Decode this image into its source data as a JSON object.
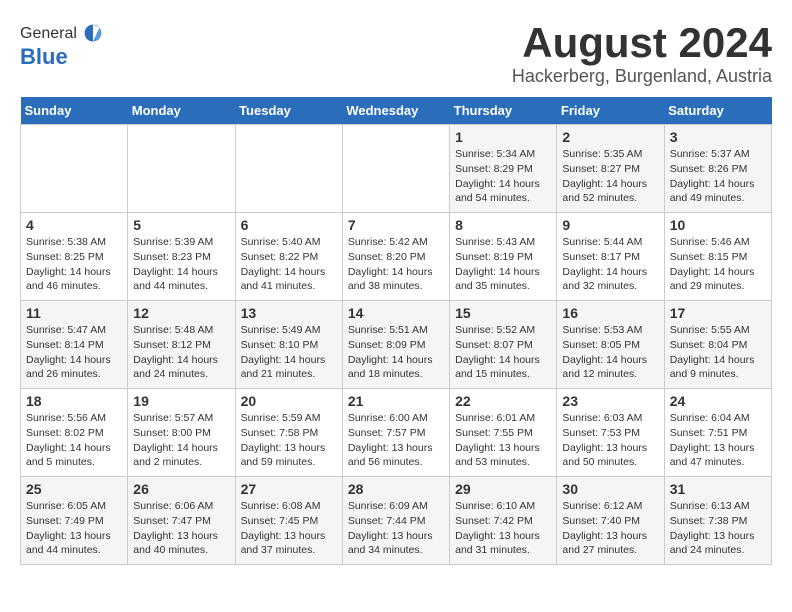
{
  "logo": {
    "general": "General",
    "blue": "Blue"
  },
  "header": {
    "month_year": "August 2024",
    "location": "Hackerberg, Burgenland, Austria"
  },
  "days_of_week": [
    "Sunday",
    "Monday",
    "Tuesday",
    "Wednesday",
    "Thursday",
    "Friday",
    "Saturday"
  ],
  "weeks": [
    [
      {
        "day": "",
        "info": ""
      },
      {
        "day": "",
        "info": ""
      },
      {
        "day": "",
        "info": ""
      },
      {
        "day": "",
        "info": ""
      },
      {
        "day": "1",
        "info": "Sunrise: 5:34 AM\nSunset: 8:29 PM\nDaylight: 14 hours\nand 54 minutes."
      },
      {
        "day": "2",
        "info": "Sunrise: 5:35 AM\nSunset: 8:27 PM\nDaylight: 14 hours\nand 52 minutes."
      },
      {
        "day": "3",
        "info": "Sunrise: 5:37 AM\nSunset: 8:26 PM\nDaylight: 14 hours\nand 49 minutes."
      }
    ],
    [
      {
        "day": "4",
        "info": "Sunrise: 5:38 AM\nSunset: 8:25 PM\nDaylight: 14 hours\nand 46 minutes."
      },
      {
        "day": "5",
        "info": "Sunrise: 5:39 AM\nSunset: 8:23 PM\nDaylight: 14 hours\nand 44 minutes."
      },
      {
        "day": "6",
        "info": "Sunrise: 5:40 AM\nSunset: 8:22 PM\nDaylight: 14 hours\nand 41 minutes."
      },
      {
        "day": "7",
        "info": "Sunrise: 5:42 AM\nSunset: 8:20 PM\nDaylight: 14 hours\nand 38 minutes."
      },
      {
        "day": "8",
        "info": "Sunrise: 5:43 AM\nSunset: 8:19 PM\nDaylight: 14 hours\nand 35 minutes."
      },
      {
        "day": "9",
        "info": "Sunrise: 5:44 AM\nSunset: 8:17 PM\nDaylight: 14 hours\nand 32 minutes."
      },
      {
        "day": "10",
        "info": "Sunrise: 5:46 AM\nSunset: 8:15 PM\nDaylight: 14 hours\nand 29 minutes."
      }
    ],
    [
      {
        "day": "11",
        "info": "Sunrise: 5:47 AM\nSunset: 8:14 PM\nDaylight: 14 hours\nand 26 minutes."
      },
      {
        "day": "12",
        "info": "Sunrise: 5:48 AM\nSunset: 8:12 PM\nDaylight: 14 hours\nand 24 minutes."
      },
      {
        "day": "13",
        "info": "Sunrise: 5:49 AM\nSunset: 8:10 PM\nDaylight: 14 hours\nand 21 minutes."
      },
      {
        "day": "14",
        "info": "Sunrise: 5:51 AM\nSunset: 8:09 PM\nDaylight: 14 hours\nand 18 minutes."
      },
      {
        "day": "15",
        "info": "Sunrise: 5:52 AM\nSunset: 8:07 PM\nDaylight: 14 hours\nand 15 minutes."
      },
      {
        "day": "16",
        "info": "Sunrise: 5:53 AM\nSunset: 8:05 PM\nDaylight: 14 hours\nand 12 minutes."
      },
      {
        "day": "17",
        "info": "Sunrise: 5:55 AM\nSunset: 8:04 PM\nDaylight: 14 hours\nand 9 minutes."
      }
    ],
    [
      {
        "day": "18",
        "info": "Sunrise: 5:56 AM\nSunset: 8:02 PM\nDaylight: 14 hours\nand 5 minutes."
      },
      {
        "day": "19",
        "info": "Sunrise: 5:57 AM\nSunset: 8:00 PM\nDaylight: 14 hours\nand 2 minutes."
      },
      {
        "day": "20",
        "info": "Sunrise: 5:59 AM\nSunset: 7:58 PM\nDaylight: 13 hours\nand 59 minutes."
      },
      {
        "day": "21",
        "info": "Sunrise: 6:00 AM\nSunset: 7:57 PM\nDaylight: 13 hours\nand 56 minutes."
      },
      {
        "day": "22",
        "info": "Sunrise: 6:01 AM\nSunset: 7:55 PM\nDaylight: 13 hours\nand 53 minutes."
      },
      {
        "day": "23",
        "info": "Sunrise: 6:03 AM\nSunset: 7:53 PM\nDaylight: 13 hours\nand 50 minutes."
      },
      {
        "day": "24",
        "info": "Sunrise: 6:04 AM\nSunset: 7:51 PM\nDaylight: 13 hours\nand 47 minutes."
      }
    ],
    [
      {
        "day": "25",
        "info": "Sunrise: 6:05 AM\nSunset: 7:49 PM\nDaylight: 13 hours\nand 44 minutes."
      },
      {
        "day": "26",
        "info": "Sunrise: 6:06 AM\nSunset: 7:47 PM\nDaylight: 13 hours\nand 40 minutes."
      },
      {
        "day": "27",
        "info": "Sunrise: 6:08 AM\nSunset: 7:45 PM\nDaylight: 13 hours\nand 37 minutes."
      },
      {
        "day": "28",
        "info": "Sunrise: 6:09 AM\nSunset: 7:44 PM\nDaylight: 13 hours\nand 34 minutes."
      },
      {
        "day": "29",
        "info": "Sunrise: 6:10 AM\nSunset: 7:42 PM\nDaylight: 13 hours\nand 31 minutes."
      },
      {
        "day": "30",
        "info": "Sunrise: 6:12 AM\nSunset: 7:40 PM\nDaylight: 13 hours\nand 27 minutes."
      },
      {
        "day": "31",
        "info": "Sunrise: 6:13 AM\nSunset: 7:38 PM\nDaylight: 13 hours\nand 24 minutes."
      }
    ]
  ]
}
